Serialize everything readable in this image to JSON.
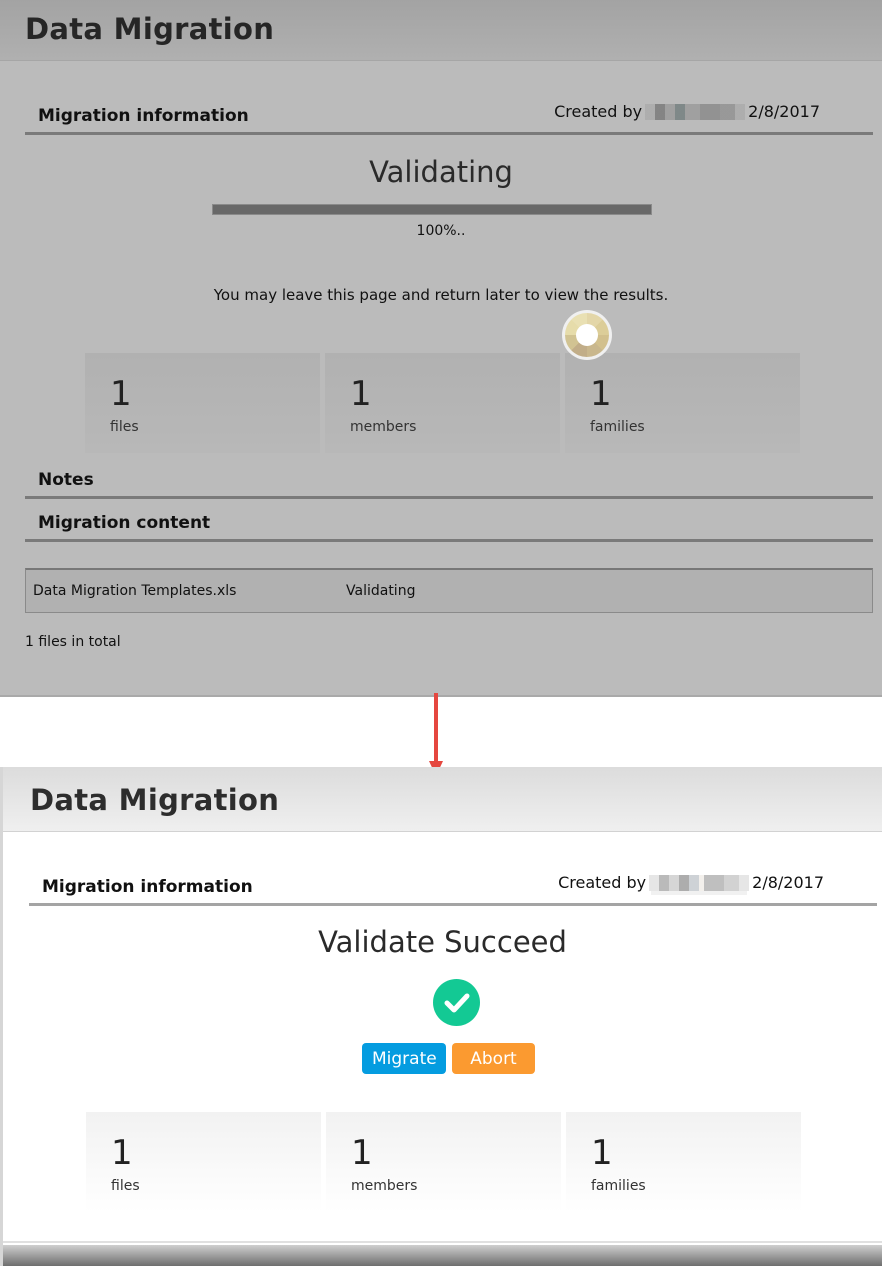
{
  "top_panel": {
    "page_title": "Data Migration",
    "info_section": {
      "title": "Migration information",
      "created_by_label": "Created by",
      "created_date": "2/8/2017"
    },
    "status": "Validating",
    "progress_percent": 100,
    "progress_text": "100%..",
    "leave_note": "You may leave this page and return later to view the results.",
    "stats": [
      {
        "value": "1",
        "label": "files"
      },
      {
        "value": "1",
        "label": "members"
      },
      {
        "value": "1",
        "label": "families"
      }
    ],
    "notes_title": "Notes",
    "content_title": "Migration content",
    "files": [
      {
        "name": "Data Migration Templates.xls",
        "status": "Validating"
      }
    ],
    "files_total": "1 files in total"
  },
  "bottom_panel": {
    "page_title": "Data Migration",
    "info_section": {
      "title": "Migration information",
      "created_by_label": "Created by",
      "created_date": "2/8/2017"
    },
    "status": "Validate Succeed",
    "buttons": {
      "migrate": "Migrate",
      "abort": "Abort"
    },
    "stats": [
      {
        "value": "1",
        "label": "files"
      },
      {
        "value": "1",
        "label": "members"
      },
      {
        "value": "1",
        "label": "families"
      }
    ]
  },
  "colors": {
    "success": "#13c994",
    "migrate_button": "#049ce0",
    "abort_button": "#fb9a30",
    "arrow": "#e5473f"
  },
  "icons": {
    "loading": "loading-spinner-icon",
    "success": "check-circle-icon",
    "transition": "arrow-down-icon"
  }
}
